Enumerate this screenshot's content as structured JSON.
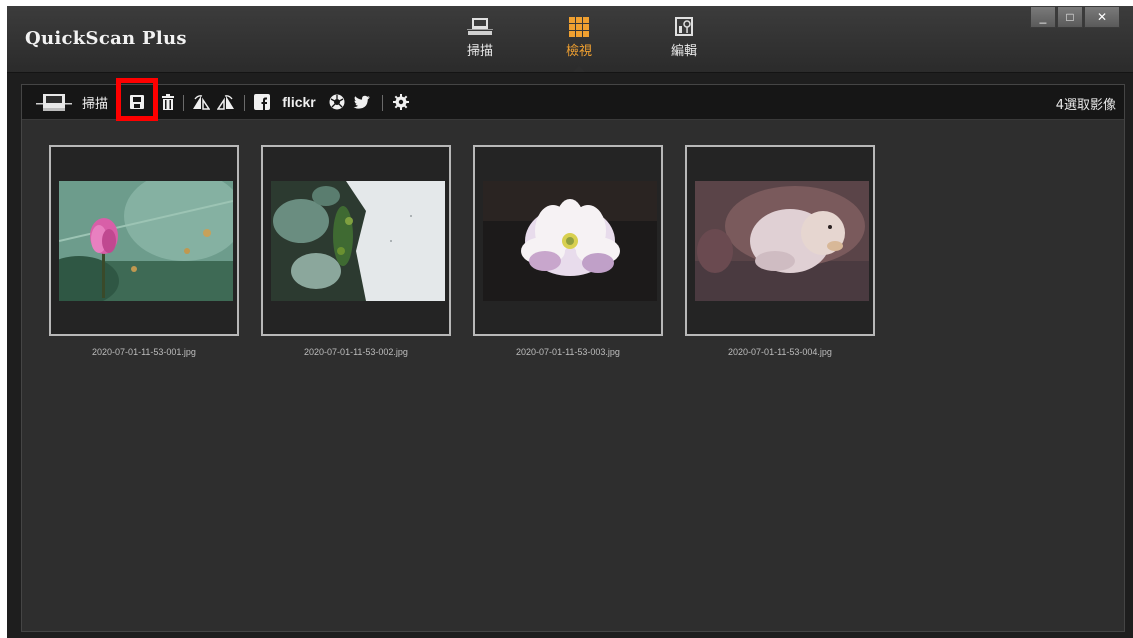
{
  "app": {
    "title": "QuickScan Plus"
  },
  "modes": [
    {
      "label": "掃描",
      "icon": "scanner-icon",
      "active": false
    },
    {
      "label": "檢視",
      "icon": "grid-view-icon",
      "active": true
    },
    {
      "label": "編輯",
      "icon": "edit-icon",
      "active": false
    }
  ],
  "window_controls": {
    "minimize": "_",
    "maximize": "□",
    "close": "✕"
  },
  "toolbar": {
    "scan_label": "掃描",
    "flickr_label": "flickr",
    "selection_count": "4選取影像"
  },
  "photos": [
    {
      "filename": "2020-07-01-11-53-001.jpg"
    },
    {
      "filename": "2020-07-01-11-53-002.jpg"
    },
    {
      "filename": "2020-07-01-11-53-003.jpg"
    },
    {
      "filename": "2020-07-01-11-53-004.jpg"
    }
  ],
  "colors": {
    "accent": "#f0a030",
    "highlight": "#ff0000"
  }
}
